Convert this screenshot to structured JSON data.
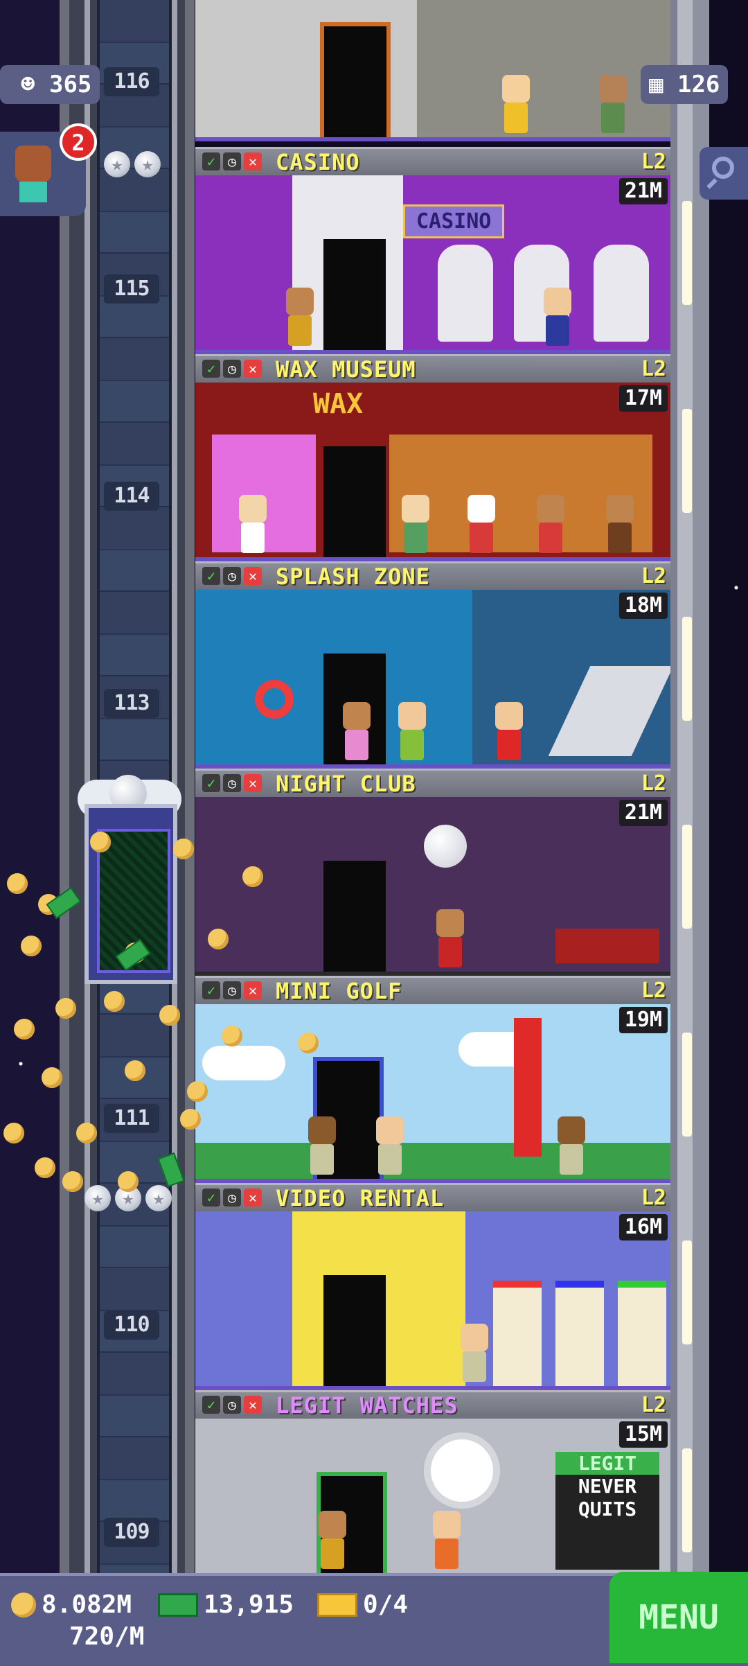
{
  "top_left_badge": {
    "icon": "resident-icon",
    "value": "365"
  },
  "top_right_badge": {
    "icon": "floors-icon",
    "value": "126"
  },
  "vip_notification": {
    "count": "2"
  },
  "floor_numbers": [
    "116",
    "115",
    "114",
    "113",
    "111",
    "110",
    "109"
  ],
  "floors": [
    {
      "name": "CASINO",
      "level": "L2",
      "income": "21M",
      "name_color": "#fff56a"
    },
    {
      "name": "WAX MUSEUM",
      "level": "L2",
      "income": "17M",
      "name_color": "#fff56a"
    },
    {
      "name": "SPLASH ZONE",
      "level": "L2",
      "income": "18M",
      "name_color": "#fff56a"
    },
    {
      "name": "NIGHT CLUB",
      "level": "L2",
      "income": "21M",
      "name_color": "#fff56a"
    },
    {
      "name": "MINI GOLF",
      "level": "L2",
      "income": "19M",
      "name_color": "#fff56a"
    },
    {
      "name": "VIDEO RENTAL",
      "level": "L2",
      "income": "16M",
      "name_color": "#fff56a"
    },
    {
      "name": "LEGIT WATCHES",
      "level": "L2",
      "income": "15M",
      "name_color": "#e08cff"
    }
  ],
  "room_signs": {
    "casino": "CASINO",
    "wax": "WAX",
    "watches_sign_1": "LEGIT",
    "watches_sign_2": "NEVER",
    "watches_sign_3": "QUITS"
  },
  "bottom_bar": {
    "coins": "8.082M",
    "coin_rate": "720/M",
    "bux": "13,915",
    "tickets": "0/4",
    "menu_label": "MENU"
  }
}
